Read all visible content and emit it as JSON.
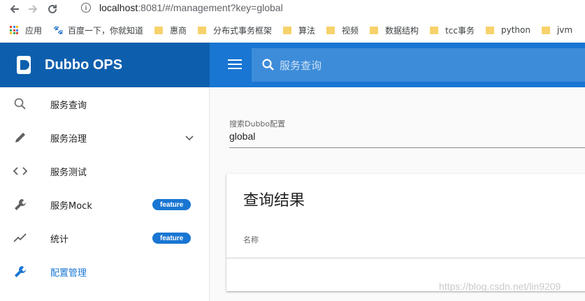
{
  "browser": {
    "url_host": "localhost",
    "url_path": ":8081/#/management?key=global"
  },
  "bookmarks": [
    {
      "label": "应用",
      "icon": "apps-icon"
    },
    {
      "label": "百度一下，你就知道",
      "icon": "baidu-paw-icon"
    },
    {
      "label": "惠商",
      "icon": "folder-icon"
    },
    {
      "label": "分布式事务框架",
      "icon": "folder-icon"
    },
    {
      "label": "算法",
      "icon": "folder-icon"
    },
    {
      "label": "视频",
      "icon": "folder-icon"
    },
    {
      "label": "数据结构",
      "icon": "folder-icon"
    },
    {
      "label": "tcc事务",
      "icon": "folder-icon"
    },
    {
      "label": "python",
      "icon": "folder-icon"
    },
    {
      "label": "jvm",
      "icon": "folder-icon"
    }
  ],
  "header": {
    "brand": "Dubbo OPS",
    "search_placeholder": "服务查询"
  },
  "sidebar": {
    "items": [
      {
        "label": "服务查询",
        "icon": "search-icon"
      },
      {
        "label": "服务治理",
        "icon": "pencil-icon",
        "expandable": true
      },
      {
        "label": "服务测试",
        "icon": "code-icon"
      },
      {
        "label": "服务Mock",
        "icon": "wrench-icon",
        "badge": "feature"
      },
      {
        "label": "统计",
        "icon": "trend-icon",
        "badge": "feature"
      },
      {
        "label": "配置管理",
        "icon": "wrench-icon",
        "active": true
      }
    ]
  },
  "main": {
    "search_label": "搜索Dubbo配置",
    "search_value": "global",
    "result_title": "查询结果",
    "column_name": "名称"
  },
  "watermark": "https://blog.csdn.net/lin9209",
  "colors": {
    "brand_bg": "#0d5fad",
    "toolbar_bg": "#1976d2",
    "active": "#1976d2"
  }
}
